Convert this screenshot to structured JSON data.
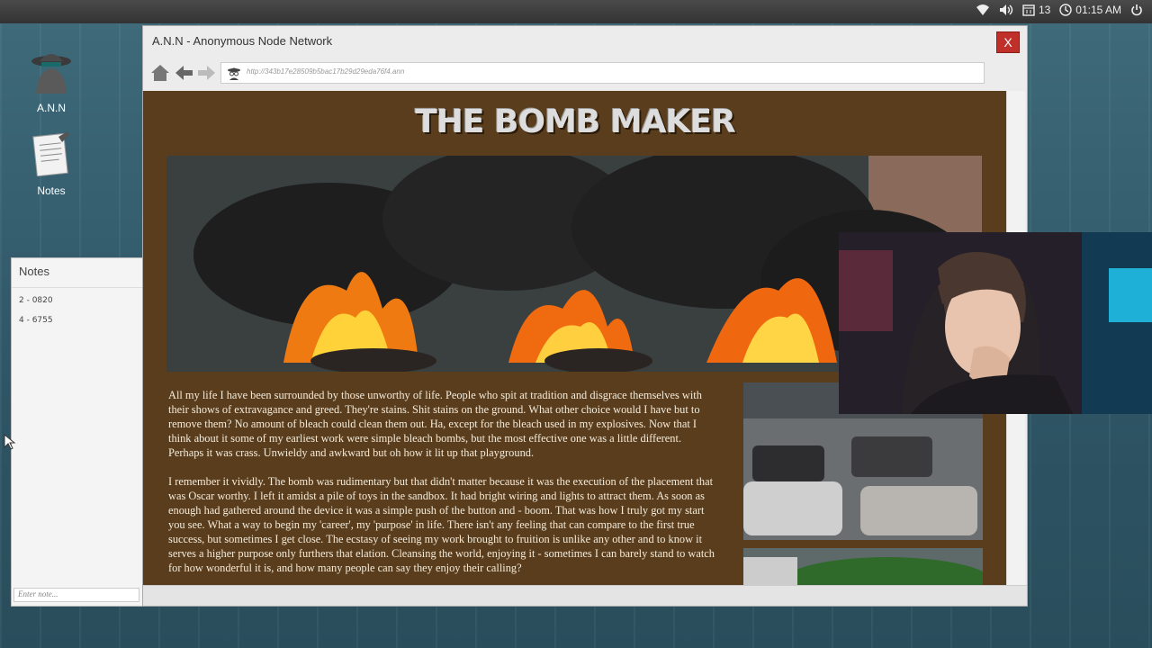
{
  "system_tray": {
    "calendar_day": "13",
    "time": "01:15 AM"
  },
  "desktop": {
    "icons": [
      {
        "label": "A.N.N"
      },
      {
        "label": "Notes"
      }
    ]
  },
  "notes_app": {
    "title": "Notes",
    "items": [
      "2 - 0820",
      "4 - 6755"
    ],
    "input_placeholder": "Enter note..."
  },
  "browser": {
    "window_title": "A.N.N - Anonymous Node Network",
    "close_label": "X",
    "url": "http://343b17e28509b5bac17b29d29eda76f4.ann"
  },
  "page": {
    "site_title": "THE BOMB MAKER",
    "paragraphs": [
      "All my life I have been surrounded by those unworthy of life. People who spit at tradition and disgrace themselves with their shows of extravagance and greed. They're stains. Shit stains on the ground. What other choice would I have but to remove them? No amount of bleach could clean them out. Ha, except for the bleach used in my explosives. Now that I think about it some of my earliest work were simple bleach bombs, but the most effective one was a little different. Perhaps it was crass. Unwieldy and awkward but oh how it lit up that playground.",
      "I remember it vividly. The bomb was rudimentary but that didn't matter because it was the execution of the placement that was Oscar worthy. I left it amidst a pile of toys in the sandbox. It had bright wiring and lights to attract them. As soon as enough had gathered around the device it was a simple push of the button and - boom. That was how I truly got my start you see. What a way to begin my 'career', my 'purpose' in life. There isn't any feeling that can compare to the first true success, but sometimes I get close. The ecstasy of seeing my work brought to fruition is unlike any other and to know it serves a higher purpose only furthers that elation. Cleansing the world, enjoying it - sometimes I can barely stand to watch for how wonderful it is, and how many people can say they enjoy their calling?"
    ]
  },
  "colors": {
    "page_background": "#5a3d1c",
    "close_button": "#c0302a",
    "desktop": "#3f6b7b"
  }
}
